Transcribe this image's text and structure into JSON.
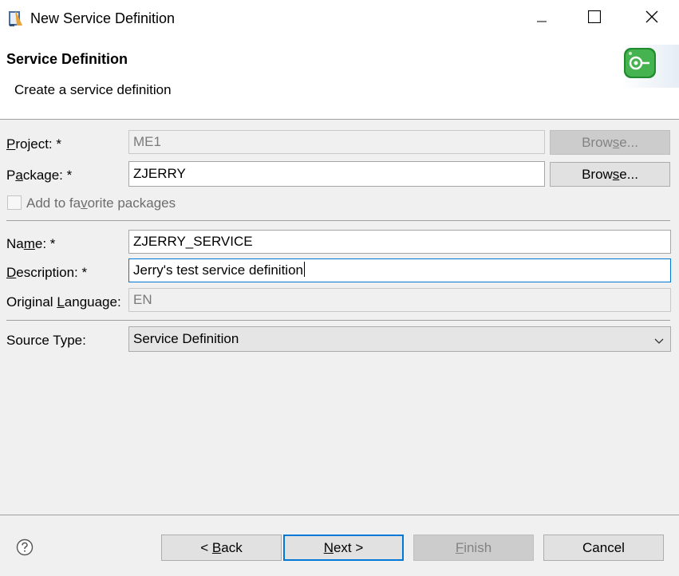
{
  "window": {
    "title": "New Service Definition",
    "icons": {
      "app": "eclipse-app-icon",
      "minimize": "minimize-icon",
      "maximize": "maximize-icon",
      "close": "close-icon"
    }
  },
  "header": {
    "title": "Service Definition",
    "subtitle": "Create a service definition",
    "image": "service-definition-wizard-icon"
  },
  "form": {
    "project": {
      "label_pre": "",
      "label_key": "P",
      "label_post": "roject: *",
      "value": "ME1"
    },
    "package": {
      "label_pre": "P",
      "label_key": "a",
      "label_post": "ckage: *",
      "value": "ZJERRY"
    },
    "browse_disabled": {
      "pre": "Brow",
      "key": "s",
      "post": "e..."
    },
    "browse_enabled": {
      "pre": "Brow",
      "key": "s",
      "post": "e..."
    },
    "favorite": {
      "pre": "Add to fa",
      "key": "v",
      "post": "orite packages",
      "checked": false
    },
    "name": {
      "label_pre": "Na",
      "label_key": "m",
      "label_post": "e: *",
      "value": "ZJERRY_SERVICE"
    },
    "description": {
      "label_pre": "",
      "label_key": "D",
      "label_post": "escription: *",
      "value": "Jerry's test service definition"
    },
    "original_language": {
      "label_pre": "Original ",
      "label_key": "L",
      "label_post": "anguage:",
      "value": "EN"
    },
    "source_type": {
      "label": "Source Type:",
      "value": "Service Definition",
      "icon": "chevron-down-icon"
    }
  },
  "footer": {
    "help_icon": "help-icon",
    "back": {
      "pre": "< ",
      "key": "B",
      "post": "ack"
    },
    "next": {
      "pre": "",
      "key": "N",
      "post": "ext >"
    },
    "finish": {
      "pre": "",
      "key": "F",
      "post": "inish"
    },
    "cancel": {
      "label": "Cancel"
    }
  },
  "colors": {
    "accent": "#0078d7",
    "header_icon_green": "#3aa845",
    "window_bg": "#f0f0f0"
  }
}
